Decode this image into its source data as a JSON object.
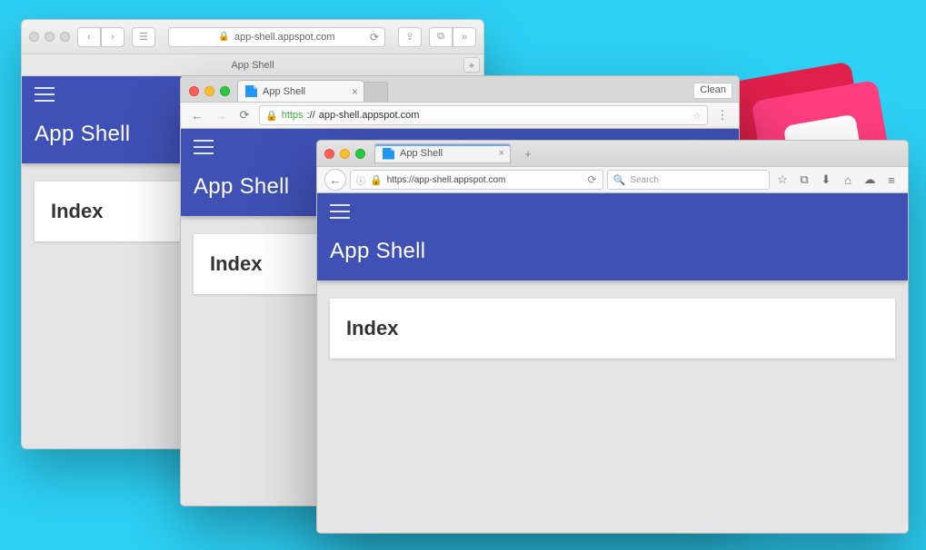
{
  "app": {
    "title": "App Shell",
    "content_heading": "Index"
  },
  "safari": {
    "address": "app-shell.appspot.com",
    "tab_label": "App Shell"
  },
  "chrome": {
    "tab_label": "App Shell",
    "clean_label": "Clean",
    "url_scheme": "https",
    "url_sep": "://",
    "url_rest": "app-shell.appspot.com"
  },
  "firefox": {
    "tab_label": "App Shell",
    "url": "https://app-shell.appspot.com",
    "search_placeholder": "Search"
  }
}
